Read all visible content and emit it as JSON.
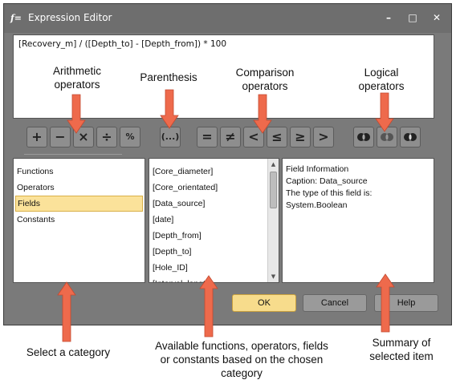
{
  "window": {
    "title": "Expression Editor",
    "app_icon": "f=",
    "controls": [
      "–",
      "□",
      "✕"
    ]
  },
  "expression": "[Recovery_m] / ([Depth_to] - [Depth_from]) * 100",
  "toolbar": {
    "arithmetic": [
      "+",
      "−",
      "×",
      "÷",
      "%"
    ],
    "parenthesis": "(...)",
    "comparison": [
      "=",
      "≠",
      "<",
      "≤",
      "≥",
      ">"
    ],
    "logical": [
      "and-icon",
      "or-icon",
      "not-icon"
    ]
  },
  "categories": {
    "items": [
      "Functions",
      "Operators",
      "Fields",
      "Constants"
    ],
    "selected": "Fields"
  },
  "fields": [
    "[Core_diameter]",
    "[Core_orientated]",
    "[Data_source]",
    "[date]",
    "[Depth_from]",
    "[Depth_to]",
    "[Hole_ID]",
    "[Interval_length]"
  ],
  "info": {
    "lines": [
      "Field Information",
      "Caption: Data_source",
      "The type of this field is:",
      "System.Boolean"
    ]
  },
  "buttons": {
    "ok": "OK",
    "cancel": "Cancel",
    "help": "Help"
  },
  "annotations": {
    "arithmetic": [
      "Arithmetic",
      "operators"
    ],
    "parenthesis": [
      "Parenthesis"
    ],
    "comparison": [
      "Comparison",
      "operators"
    ],
    "logical": [
      "Logical",
      "operators"
    ],
    "category": [
      "Select a category"
    ],
    "available": [
      "Available functions, operators, fields",
      "or constants based on the chosen",
      "category"
    ],
    "summary": [
      "Summary of",
      "selected item"
    ]
  },
  "colors": {
    "arrow": "#ee6a4c",
    "selection": "#fbe29a",
    "window": "#7a7a7a"
  }
}
